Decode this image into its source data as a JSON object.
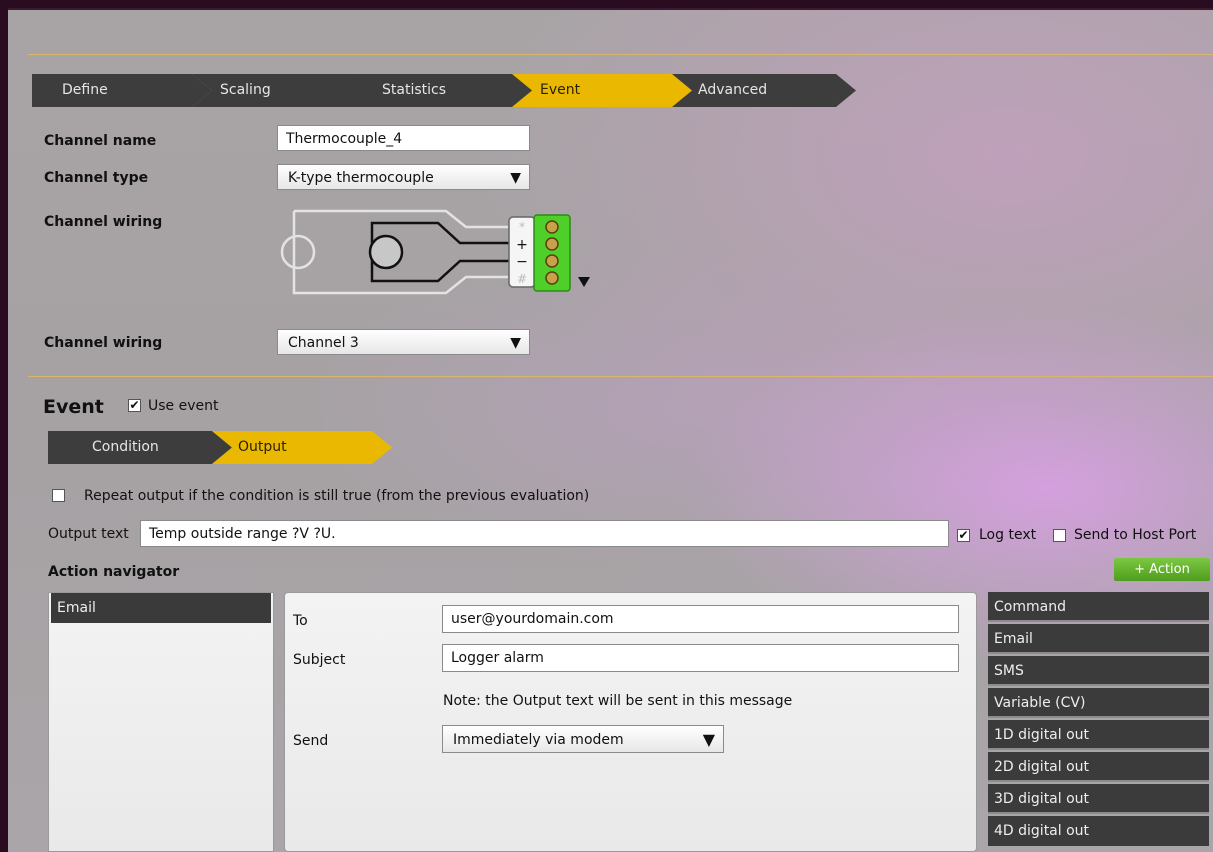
{
  "main_tabs": [
    {
      "label": "Define",
      "active": false
    },
    {
      "label": "Scaling",
      "active": false
    },
    {
      "label": "Statistics",
      "active": false
    },
    {
      "label": "Event",
      "active": true
    },
    {
      "label": "Advanced",
      "active": false
    }
  ],
  "channel": {
    "name_label": "Channel name",
    "name_value": "Thermocouple_4",
    "type_label": "Channel type",
    "type_value": "K-type thermocouple",
    "wiring_label": "Channel wiring",
    "wiring_diagram_terminals": [
      "*",
      "+",
      "−",
      "#"
    ],
    "wiring2_label": "Channel wiring",
    "wiring2_value": "Channel 3"
  },
  "event": {
    "title": "Event",
    "use_event_label": "Use event",
    "use_event_checked": true,
    "sub_tabs": [
      {
        "label": "Condition",
        "active": false
      },
      {
        "label": "Output",
        "active": true
      }
    ],
    "repeat_label": "Repeat output if the condition is still true (from the previous evaluation)",
    "repeat_checked": false,
    "output_text_label": "Output text",
    "output_text_value": "Temp outside range ?V ?U.",
    "log_text_label": "Log text",
    "log_text_checked": true,
    "send_host_label": "Send to Host Port",
    "send_host_checked": false
  },
  "action_navigator": {
    "title": "Action navigator",
    "add_action_label": "+ Action",
    "items": [
      "Email"
    ]
  },
  "email_form": {
    "to_label": "To",
    "to_value": "user@yourdomain.com",
    "subject_label": "Subject",
    "subject_value": "Logger alarm",
    "note": "Note: the Output text will be sent in this message",
    "send_label": "Send",
    "send_value": "Immediately via modem"
  },
  "action_types": [
    "Command",
    "Email",
    "SMS",
    "Variable (CV)",
    "1D digital out",
    "2D digital out",
    "3D digital out",
    "4D digital out"
  ],
  "colors": {
    "active_tab": "#eab800",
    "inactive_tab": "#3d3d3d",
    "action_button": "#5cae28",
    "terminal_green": "#4fcf2a"
  },
  "icons": {
    "dropdown": "triangle-down",
    "checkbox_checked": "check-mark"
  }
}
